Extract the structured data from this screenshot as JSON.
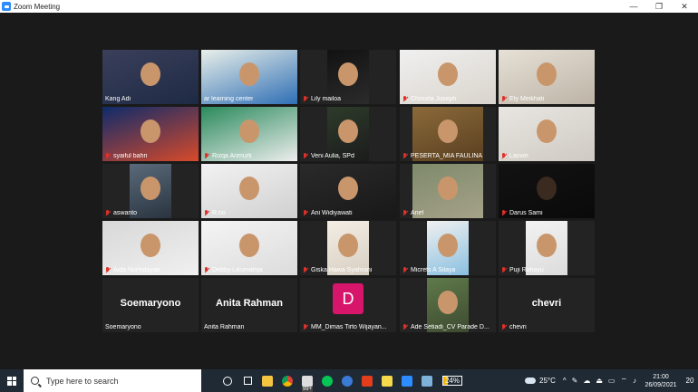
{
  "window": {
    "title": "Zoom Meeting",
    "minimize": "—",
    "maximize": "❐",
    "close": "✕"
  },
  "participants": [
    {
      "name": "Kang Adi",
      "muted": false,
      "type": "video"
    },
    {
      "name": "ar learning center",
      "muted": false,
      "type": "video",
      "active": true
    },
    {
      "name": "Lily mailoa",
      "muted": true,
      "type": "video"
    },
    {
      "name": "Chricela Joseph",
      "muted": true,
      "type": "video"
    },
    {
      "name": "Ety Meikhati",
      "muted": true,
      "type": "video"
    },
    {
      "name": "syaiful bahri",
      "muted": true,
      "type": "video"
    },
    {
      "name": "Rizqa Arimurti",
      "muted": true,
      "type": "video"
    },
    {
      "name": "Veni Aulia, SPd",
      "muted": true,
      "type": "video"
    },
    {
      "name": "PESERTA_MIA FAULINA",
      "muted": true,
      "type": "video"
    },
    {
      "name": "Lanvin",
      "muted": true,
      "type": "video"
    },
    {
      "name": "aswanto",
      "muted": true,
      "type": "video"
    },
    {
      "name": "R.no",
      "muted": true,
      "type": "video"
    },
    {
      "name": "Ani Widiyawati",
      "muted": true,
      "type": "video"
    },
    {
      "name": "Arief",
      "muted": true,
      "type": "video"
    },
    {
      "name": "Darus Sami",
      "muted": true,
      "type": "video"
    },
    {
      "name": "Aida Nurhidayati",
      "muted": true,
      "type": "video"
    },
    {
      "name": "Debby Likumahija",
      "muted": true,
      "type": "video"
    },
    {
      "name": "Giska Hawa Syahrani",
      "muted": true,
      "type": "video"
    },
    {
      "name": "Micrets A Silaya",
      "muted": true,
      "type": "video"
    },
    {
      "name": "Puji Rahayu",
      "muted": true,
      "type": "video"
    },
    {
      "name": "Soemaryono",
      "muted": false,
      "type": "name",
      "display": "Soemaryono"
    },
    {
      "name": "Anita Rahman",
      "muted": false,
      "type": "name",
      "display": "Anita Rahman"
    },
    {
      "name": "MM_Dimas Tirto Wijayan...",
      "muted": true,
      "type": "avatar",
      "display": "D"
    },
    {
      "name": "Ade Setiadi_CV Parade D...",
      "muted": true,
      "type": "video"
    },
    {
      "name": "chevri",
      "muted": true,
      "type": "name",
      "display": "chevri"
    }
  ],
  "taskbar": {
    "search_placeholder": "Type here to search",
    "badge": "99+",
    "battery": "24%",
    "weather_temp": "25°C",
    "time": "21:00",
    "date": "26/09/2021",
    "notifications": "20"
  }
}
